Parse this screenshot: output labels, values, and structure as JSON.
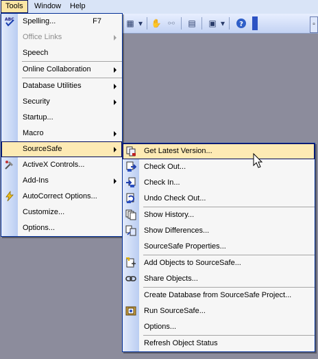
{
  "menubar": {
    "tools": "Tools",
    "window": "Window",
    "help": "Help"
  },
  "tools_menu": {
    "spelling": "Spelling...",
    "spelling_shortcut": "F7",
    "office_links": "Office Links",
    "speech": "Speech",
    "online_collaboration": "Online Collaboration",
    "database_utilities": "Database Utilities",
    "security": "Security",
    "startup": "Startup...",
    "macro": "Macro",
    "sourcesafe": "SourceSafe",
    "activex": "ActiveX Controls...",
    "addins": "Add-Ins",
    "autocorrect": "AutoCorrect Options...",
    "customize": "Customize...",
    "options": "Options..."
  },
  "sourcesafe_menu": {
    "get_latest": "Get Latest Version...",
    "check_out": "Check Out...",
    "check_in": "Check In...",
    "undo_check_out": "Undo Check Out...",
    "show_history": "Show History...",
    "show_differences": "Show Differences...",
    "properties": "SourceSafe Properties...",
    "add_objects": "Add Objects to SourceSafe...",
    "share_objects": "Share Objects...",
    "create_database": "Create Database from SourceSafe Project...",
    "run_sourcesafe": "Run SourceSafe...",
    "options": "Options...",
    "refresh": "Refresh Object Status"
  },
  "colors": {
    "highlight": "#fdeab4",
    "menu_border": "#002d96",
    "gutter": "#bacdf2"
  }
}
